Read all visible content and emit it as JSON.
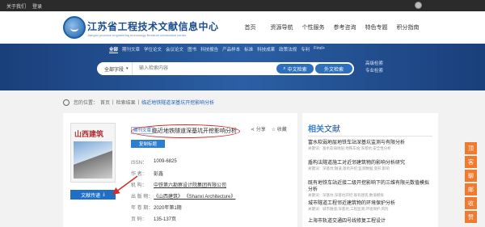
{
  "topbar": {
    "links": [
      "关于我们",
      "登录"
    ]
  },
  "header": {
    "title": "江苏省工程技术文献信息中心",
    "subtitle": "Jiangsu province engineering technology literature information center",
    "nav": [
      "首页",
      "资源导航",
      "个性服务",
      "参考咨询",
      "特色专题",
      "积分指南"
    ]
  },
  "search": {
    "tabs": [
      "全部",
      "期刊文章",
      "学位论文",
      "会议论文",
      "图书",
      "科技报告",
      "产品样本",
      "标准",
      "科技成果",
      "政策法规",
      "专利",
      "Find+"
    ],
    "scope": "全部字段",
    "placeholder": "输入检索内容",
    "cn_button": "中文检索",
    "en_button": "外文检索",
    "advanced": "高级检索",
    "professional": "专业检索"
  },
  "breadcrumb": {
    "label": "您的位置：",
    "items": [
      "首页",
      "检索结果",
      "临近地铁隧道深基坑开挖影响分析"
    ]
  },
  "article": {
    "type": "期刊文章",
    "title": "临近地铁隧道深基坑开挖影响分析",
    "copy_button": "复制标题",
    "share": "分享",
    "favorite": "收藏",
    "cover_title": "山西建筑",
    "read_button": "文献传递",
    "meta": [
      {
        "key": "ISSN：",
        "value": "1009-6825",
        "link": false
      },
      {
        "key": "作 者：",
        "value": "彭鑫",
        "link": false
      },
      {
        "key": "机 构：",
        "value": "中铁第六勘察设计院集团有限公司",
        "link": true
      },
      {
        "key": "出 版 物：",
        "value": "《山西建筑》  《Shanxi Architecture》",
        "link": true
      },
      {
        "key": "年 卷 期：",
        "value": "2020年第1期",
        "link": false
      },
      {
        "key": "页 码：",
        "value": "135-137页",
        "link": false
      }
    ]
  },
  "related": {
    "title_main": "相关",
    "title_sub": "文献",
    "items": [
      {
        "title": "富水软弱地层地铁车站深基坑监测与有限分析",
        "sub": "关键词：富水软弱地层;地铁车站;深基坑;安全性分析"
      },
      {
        "title": "盾构法隧道施工对近邻建筑物的影响分析研究",
        "sub": "关键词：深基坑;隧道;基坑开挖;监测数据;变形;影响"
      },
      {
        "title": "既有地铁车站近接二级开挖影响下的三维有限元数值模拟分析",
        "sub": "关键词：深基坑;深基坑开挖;既有建筑;数值模拟"
      },
      {
        "title": "城市隧道工程邻近建筑物的环境保护分析",
        "sub": "关键词：城市隧道;深基坑;工程监测;环境保护;风险"
      },
      {
        "title": "上海市轨道交通四号线修复工程设计",
        "sub": ""
      }
    ]
  },
  "float_buttons": [
    "顶",
    "客",
    "聊",
    "邮",
    "收",
    "赞"
  ]
}
